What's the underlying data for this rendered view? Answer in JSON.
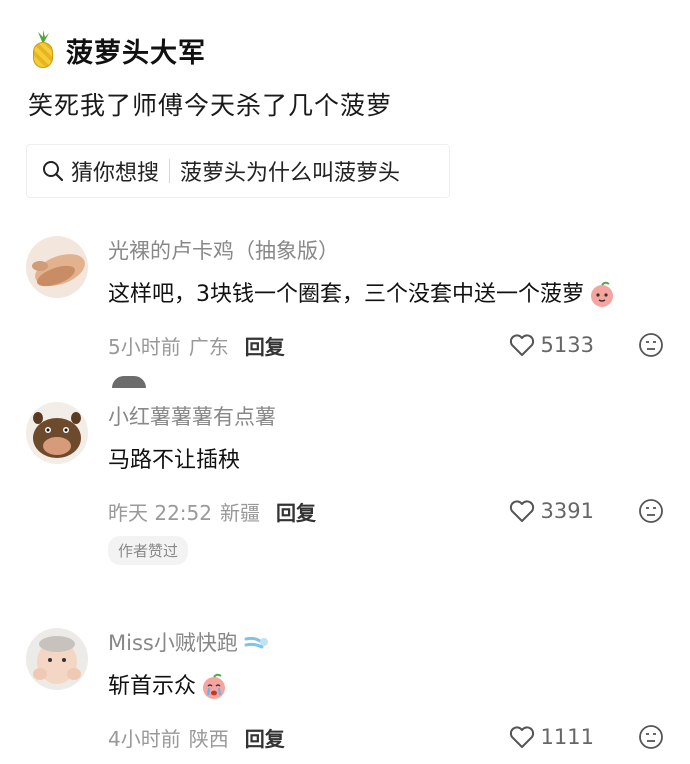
{
  "group": {
    "name": "菠萝头大军",
    "icon": "pineapple-icon"
  },
  "post": {
    "title": "笑死我了师傅今天杀了几个菠萝"
  },
  "search_hint": {
    "prefix": "猜你想搜",
    "query": "菠萝头为什么叫菠萝头"
  },
  "comments": [
    {
      "username": "光裸的卢卡鸡（抽象版）",
      "text": "这样吧，3块钱一个圈套，三个没套中送一个菠萝",
      "time": "5小时前",
      "location": "广东",
      "reply_label": "回复",
      "likes": "5133",
      "emoji": "peach-face-emoji"
    },
    {
      "username": "小红薯薯薯有点薯",
      "text": "马路不让插秧",
      "time": "昨天 22:52",
      "location": "新疆",
      "reply_label": "回复",
      "likes": "3391",
      "badge": "作者赞过"
    },
    {
      "username": "Miss小贼快跑",
      "text": "斩首示众",
      "time": "4小时前",
      "location": "陕西",
      "reply_label": "回复",
      "likes": "1111",
      "emoji": "crying-face-emoji"
    }
  ],
  "colors": {
    "username": "#888888",
    "meta": "#999999",
    "text": "#111111",
    "badge_bg": "#f3f3f3"
  }
}
